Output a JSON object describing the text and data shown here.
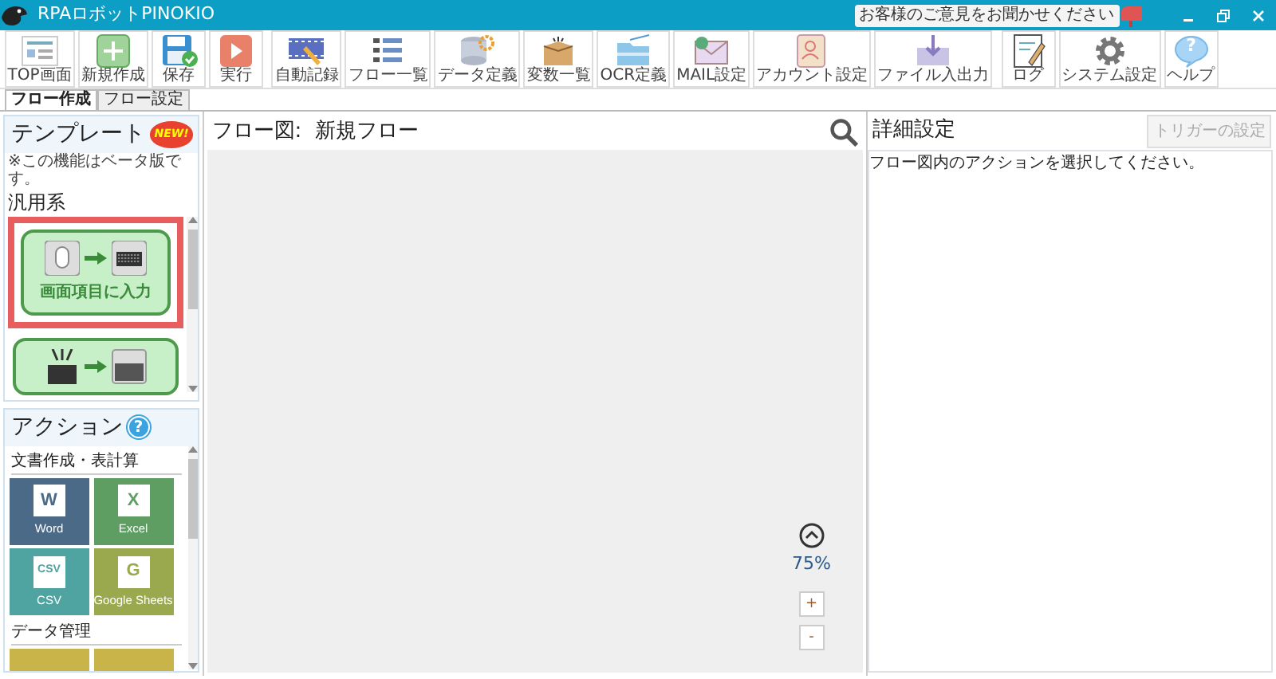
{
  "title_bar": {
    "title": "RPAロボットPINOKIO",
    "feedback": "お客様のご意見をお聞かせください"
  },
  "toolbar_groups": [
    {
      "buttons": [
        {
          "label": "TOP画面",
          "kind": "top"
        },
        {
          "label": "新規作成",
          "kind": "new"
        },
        {
          "label": "保存",
          "kind": "save"
        },
        {
          "label": "実行",
          "kind": "run"
        }
      ]
    },
    {
      "buttons": [
        {
          "label": "自動記録",
          "kind": "record"
        },
        {
          "label": "フロー一覧",
          "kind": "list"
        },
        {
          "label": "データ定義",
          "kind": "data"
        },
        {
          "label": "変数一覧",
          "kind": "box"
        },
        {
          "label": "OCR定義",
          "kind": "ocr"
        },
        {
          "label": "MAIL設定",
          "kind": "mail"
        },
        {
          "label": "アカウント設定",
          "kind": "account"
        },
        {
          "label": "ファイル入出力",
          "kind": "fileio"
        }
      ]
    },
    {
      "buttons": [
        {
          "label": "ログ",
          "kind": "log"
        },
        {
          "label": "システム設定",
          "kind": "gear"
        },
        {
          "label": "ヘルプ",
          "kind": "help",
          "glyph": "?"
        }
      ]
    }
  ],
  "tabs": [
    {
      "label": "フロー作成",
      "selected": true
    },
    {
      "label": "フロー設定",
      "selected": false
    }
  ],
  "templates": {
    "title": "テンプレート",
    "badge": "NEW!",
    "note": "※この機能はベータ版です。",
    "category": "汎用系",
    "cards": [
      {
        "kind": "mouse-to-key",
        "label": "画面項目に入力",
        "selected": true
      },
      {
        "kind": "bulb-to-screen",
        "selected": false
      }
    ]
  },
  "actions": {
    "title": "アクション",
    "help": "?",
    "groups": [
      {
        "title": "文書作成・表計算",
        "tiles": [
          {
            "glyph": "W",
            "label": "Word",
            "color": "#4b6a88"
          },
          {
            "glyph": "X",
            "label": "Excel",
            "color": "#5e9e62"
          },
          {
            "glyph": "CSV",
            "label": "CSV",
            "color": "#4fa3a0"
          },
          {
            "glyph": "G",
            "label": "Google Sheets",
            "color": "#9aa84e"
          }
        ]
      },
      {
        "title": "データ管理",
        "tiles": [
          {
            "color": "#c9b44a"
          },
          {
            "color": "#c9b44a"
          }
        ]
      }
    ]
  },
  "flow": {
    "title": "フロー図:  新規フロー",
    "zoom": "75%",
    "zoom_in": "+",
    "zoom_out": "-"
  },
  "details": {
    "title": "詳細設定",
    "trigger_button": {
      "label": "トリガーの設定",
      "disabled": true
    },
    "message": "フロー図内のアクションを選択してください。"
  }
}
